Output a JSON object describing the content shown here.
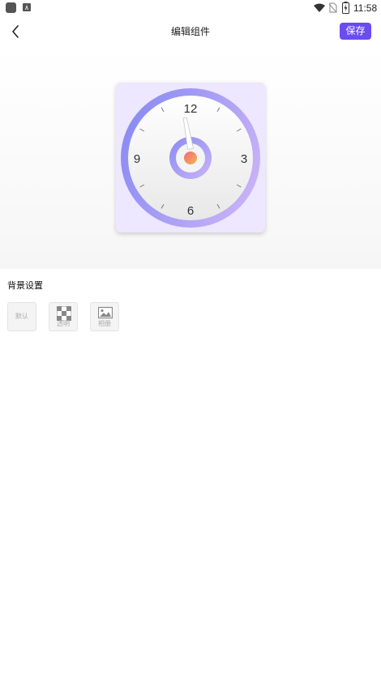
{
  "status_bar": {
    "time": "11:58",
    "icons": [
      "app-icon",
      "text-icon",
      "wifi-icon",
      "no-sim-icon",
      "battery-charging-icon"
    ]
  },
  "header": {
    "back_icon": "chevron-left-icon",
    "title": "编辑组件",
    "save_label": "保存",
    "accent_color": "#6a4cf0"
  },
  "clock_widget": {
    "numerals": {
      "top": "12",
      "right": "3",
      "bottom": "6",
      "left": "9"
    },
    "ring_colors": [
      "#8a8cf2",
      "#c9b3f7"
    ],
    "card_color": "#ede7ff",
    "center_dot_colors": [
      "#f06b7b",
      "#f5b34d"
    ]
  },
  "background_settings": {
    "title": "背景设置",
    "options": [
      {
        "label": "默认",
        "icon": "none"
      },
      {
        "label": "透明",
        "icon": "checkerboard-icon"
      },
      {
        "label": "相册",
        "icon": "image-icon"
      }
    ]
  }
}
